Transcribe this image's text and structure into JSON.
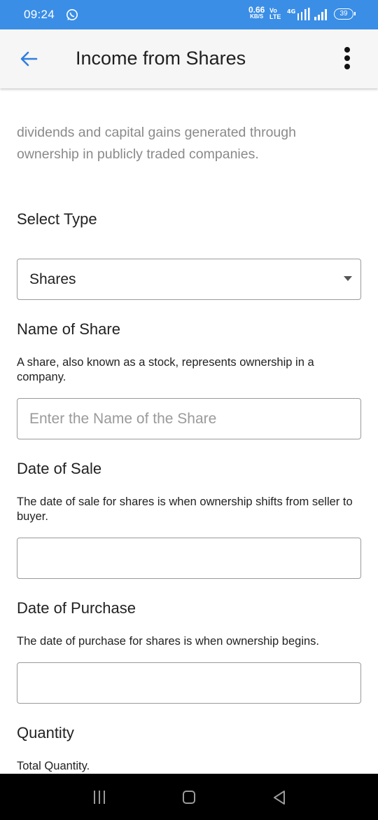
{
  "status_bar": {
    "time": "09:24",
    "net_speed_value": "0.66",
    "net_speed_unit": "KB/S",
    "volte_top": "Vo",
    "volte_bottom": "LTE",
    "network_type": "4G",
    "battery": "39",
    "icons": [
      "whatsapp-icon",
      "lte-signal-icon",
      "signal-icon",
      "battery-icon"
    ]
  },
  "app_bar": {
    "title": "Income from Shares",
    "back_icon": "arrow-left-icon",
    "menu_icon": "more-vert-icon",
    "accent_color": "#3a8ee6"
  },
  "description": "dividends and capital gains generated through ownership in publicly traded companies.",
  "select_type": {
    "label": "Select Type",
    "value": "Shares"
  },
  "name_of_share": {
    "label": "Name of Share",
    "hint": "A share, also known as a stock, represents ownership in a company.",
    "value": "",
    "placeholder": "Enter the Name of the Share"
  },
  "date_of_sale": {
    "label": "Date of Sale",
    "hint": "The date of sale for shares is when ownership shifts from seller to buyer.",
    "value": ""
  },
  "date_of_purchase": {
    "label": "Date of Purchase",
    "hint": "The date of purchase for shares is when ownership begins.",
    "value": ""
  },
  "quantity": {
    "label": "Quantity",
    "hint": "Total Quantity."
  },
  "nav_bar": {
    "icons": [
      "menu-icon",
      "home-icon",
      "back-triangle-icon"
    ]
  }
}
